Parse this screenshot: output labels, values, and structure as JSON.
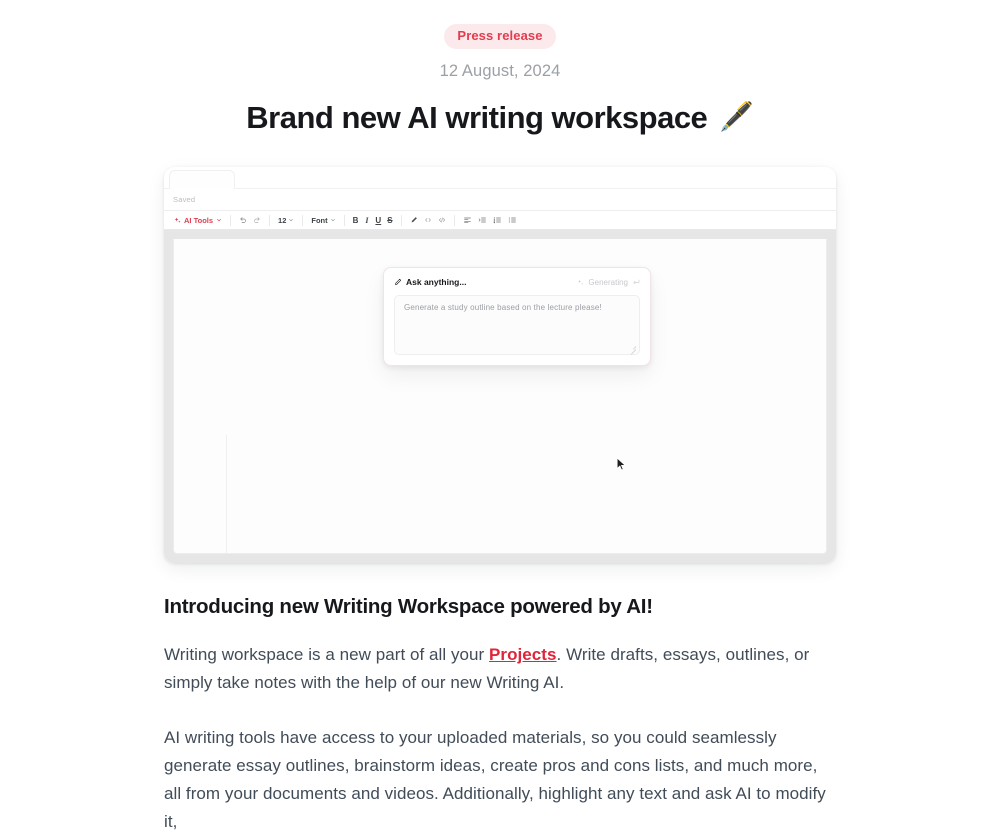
{
  "header": {
    "badge": "Press release",
    "date": "12 August, 2024",
    "title": "Brand new AI writing workspace",
    "title_emoji": "🖋️"
  },
  "hero": {
    "status_label": "Saved",
    "toolbar": {
      "ai_tools_label": "AI Tools",
      "undo_icon": "undo-icon",
      "redo_icon": "redo-icon",
      "font_size_value": "12",
      "font_family_label": "Font",
      "bold_label": "B",
      "italic_label": "I",
      "underline_label": "U",
      "strikethrough_label": "S",
      "highlight_icon": "highlighter-icon",
      "inline_code_icon": "inline-code-icon",
      "code_block_icon": "code-block-icon",
      "align_icon": "align-left-icon",
      "list_indent_icon": "list-indent-icon",
      "ordered_list_icon": "ordered-list-icon",
      "bullet_list_icon": "bullet-list-icon"
    },
    "ai_panel": {
      "title": "Ask anything...",
      "pencil_icon": "pencil-icon",
      "status": "Generating",
      "status_icon": "sparkle-icon",
      "enter_icon": "enter-key-icon",
      "prompt_value": "Generate a study outline based on the lecture please!"
    }
  },
  "article": {
    "heading": "Introducing new Writing Workspace powered by AI!",
    "p1_before": "Writing workspace is a new part of all your ",
    "p1_link": "Projects",
    "p1_after": ". Write drafts, essays, outlines, or simply take notes with the help of our new Writing AI.",
    "p2": "AI writing tools have access to your uploaded materials, so you could seamlessly generate essay outlines, brainstorm ideas, create pros and cons lists, and much more, all from your documents and videos. Additionally, highlight any text and ask AI to modify it,"
  },
  "colors": {
    "accent_red": "#e23c4e",
    "badge_bg": "#fce9ec",
    "link_red": "#e0253a",
    "body_text": "#414c58",
    "heading": "#16181c",
    "muted": "#9ca0a6"
  }
}
